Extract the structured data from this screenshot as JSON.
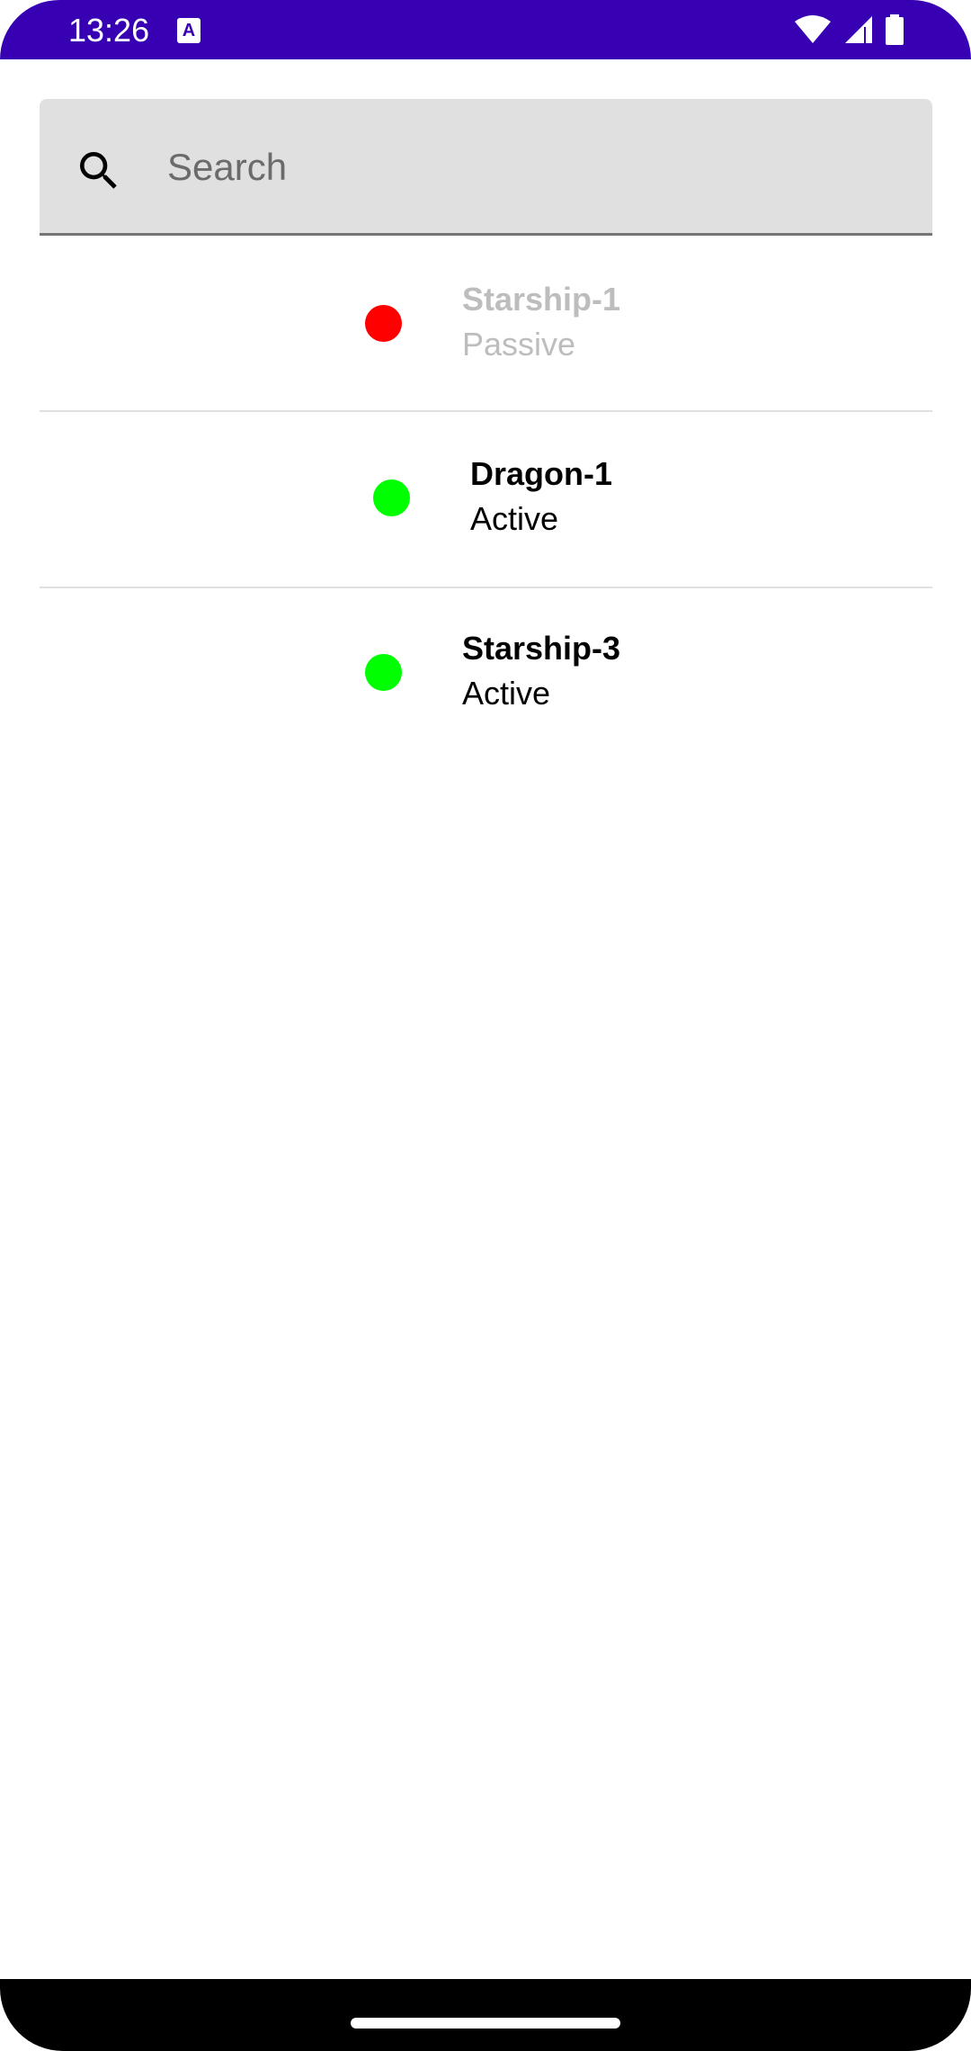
{
  "status_bar": {
    "time": "13:26",
    "notification_icon": "keyboard-a-icon",
    "notification_glyph": "A",
    "icons": [
      "wifi-icon",
      "signal-icon",
      "battery-icon"
    ],
    "background_color": "#3700b3"
  },
  "search": {
    "placeholder": "Search",
    "value": "",
    "icon": "search-icon"
  },
  "list": {
    "items": [
      {
        "name": "Starship-1",
        "state": "Passive",
        "dot_color": "#ff0000",
        "enabled": false
      },
      {
        "name": "Dragon-1",
        "state": "Active",
        "dot_color": "#00ff00",
        "enabled": true
      },
      {
        "name": "Starship-3",
        "state": "Active",
        "dot_color": "#00ff00",
        "enabled": true
      }
    ]
  },
  "colors": {
    "active": "#00ff00",
    "passive": "#ff0000",
    "disabled_text": "#bdbdbd",
    "accent": "#3700b3"
  }
}
